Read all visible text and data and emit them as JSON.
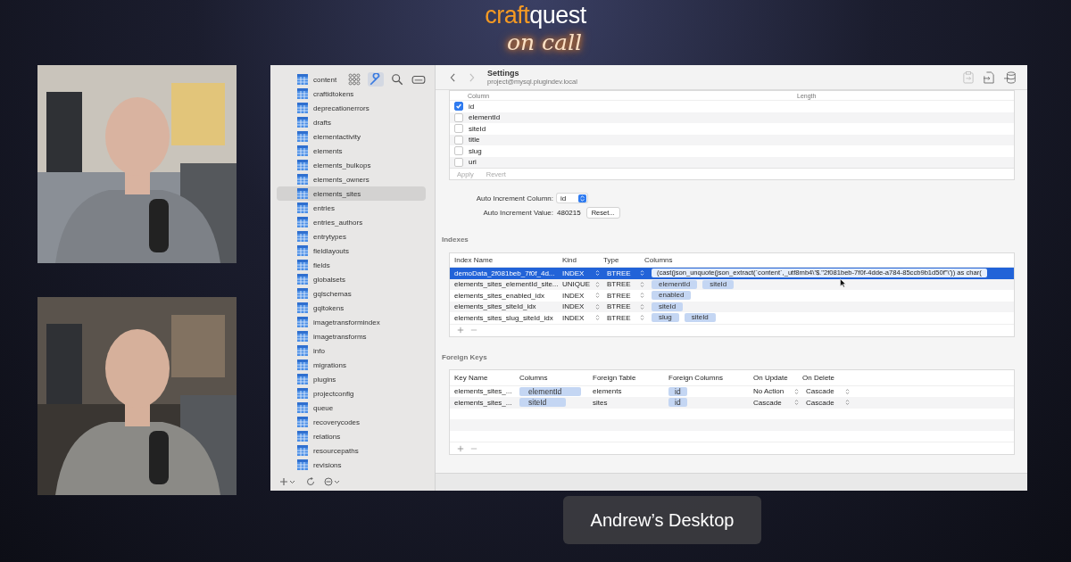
{
  "logo": {
    "first": "craft",
    "second": "quest",
    "tagline": "on call"
  },
  "sidebar": {
    "tools": [
      {
        "kind": "grid",
        "selected": false
      },
      {
        "kind": "wrench",
        "selected": true
      },
      {
        "kind": "search",
        "selected": false
      },
      {
        "kind": "drive",
        "selected": false
      }
    ],
    "tables": [
      {
        "name": "content",
        "selected": false
      },
      {
        "name": "craftidtokens",
        "selected": false
      },
      {
        "name": "deprecationerrors",
        "selected": false
      },
      {
        "name": "drafts",
        "selected": false
      },
      {
        "name": "elementactivity",
        "selected": false
      },
      {
        "name": "elements",
        "selected": false
      },
      {
        "name": "elements_bulkops",
        "selected": false
      },
      {
        "name": "elements_owners",
        "selected": false
      },
      {
        "name": "elements_sites",
        "selected": true
      },
      {
        "name": "entries",
        "selected": false
      },
      {
        "name": "entries_authors",
        "selected": false
      },
      {
        "name": "entrytypes",
        "selected": false
      },
      {
        "name": "fieldlayouts",
        "selected": false
      },
      {
        "name": "fields",
        "selected": false
      },
      {
        "name": "globalsets",
        "selected": false
      },
      {
        "name": "gqlschemas",
        "selected": false
      },
      {
        "name": "gqltokens",
        "selected": false
      },
      {
        "name": "imagetransformindex",
        "selected": false
      },
      {
        "name": "imagetransforms",
        "selected": false
      },
      {
        "name": "info",
        "selected": false
      },
      {
        "name": "migrations",
        "selected": false
      },
      {
        "name": "plugins",
        "selected": false
      },
      {
        "name": "projectconfig",
        "selected": false
      },
      {
        "name": "queue",
        "selected": false
      },
      {
        "name": "recoverycodes",
        "selected": false
      },
      {
        "name": "relations",
        "selected": false
      },
      {
        "name": "resourcepaths",
        "selected": false
      },
      {
        "name": "revisions",
        "selected": false
      }
    ]
  },
  "toolbar": {
    "title": "Settings",
    "subtitle": "project@mysql.plugindev.local"
  },
  "columns_table": {
    "headers": [
      "Column",
      "Length"
    ],
    "rows": [
      {
        "name": "id",
        "checked": true
      },
      {
        "name": "elementId",
        "checked": false
      },
      {
        "name": "siteId",
        "checked": false
      },
      {
        "name": "title",
        "checked": false
      },
      {
        "name": "slug",
        "checked": false
      },
      {
        "name": "uri",
        "checked": false
      }
    ],
    "buttons": [
      {
        "label": "Apply",
        "disabled": true
      },
      {
        "label": "Revert",
        "disabled": true
      }
    ]
  },
  "auto_increment": {
    "column_label": "Auto Increment Column:",
    "column_value": "id",
    "value_label": "Auto Increment Value:",
    "value": "480215",
    "reset_button": "Reset..."
  },
  "indexes": {
    "title": "Indexes",
    "headers": [
      "Index Name",
      "Kind",
      "Type",
      "Columns"
    ],
    "rows": [
      {
        "name": "demoData_2f081beb_7f0f_4d...",
        "kind": "INDEX",
        "type": "BTREE",
        "columns": [
          "(cast(json_unquote(json_extract(`content`,_utf8mb4\\'$.\"2f081beb-7f0f-4dde-a784-85ccb9b1d50f\"\\')) as char("
        ],
        "selected": true
      },
      {
        "name": "elements_sites_elementId_site...",
        "kind": "UNIQUE",
        "type": "BTREE",
        "columns": [
          "elementId",
          "siteId"
        ],
        "selected": false
      },
      {
        "name": "elements_sites_enabled_idx",
        "kind": "INDEX",
        "type": "BTREE",
        "columns": [
          "enabled"
        ],
        "selected": false
      },
      {
        "name": "elements_sites_siteId_idx",
        "kind": "INDEX",
        "type": "BTREE",
        "columns": [
          "siteId"
        ],
        "selected": false
      },
      {
        "name": "elements_sites_slug_siteId_idx",
        "kind": "INDEX",
        "type": "BTREE",
        "columns": [
          "slug",
          "siteId"
        ],
        "selected": false
      }
    ]
  },
  "foreign_keys": {
    "title": "Foreign Keys",
    "headers": [
      "Key Name",
      "Columns",
      "Foreign Table",
      "Foreign Columns",
      "On Update",
      "On Delete"
    ],
    "rows": [
      {
        "key_name": "elements_sites_...",
        "columns": [
          "elementId"
        ],
        "foreign_table": "elements",
        "foreign_columns": [
          "id"
        ],
        "on_update": "No Action",
        "on_delete": "Cascade"
      },
      {
        "key_name": "elements_sites_...",
        "columns": [
          "siteId"
        ],
        "foreign_table": "sites",
        "foreign_columns": [
          "id"
        ],
        "on_update": "Cascade",
        "on_delete": "Cascade"
      }
    ]
  },
  "screen_label": "Andrew’s Desktop"
}
